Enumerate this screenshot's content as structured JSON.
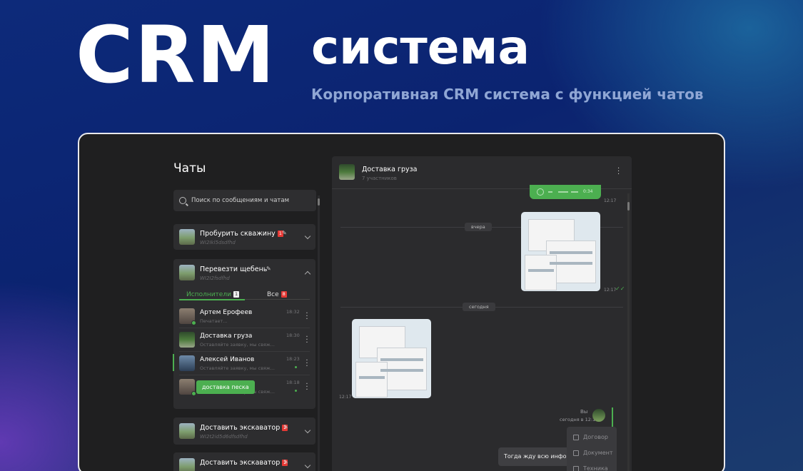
{
  "hero": {
    "title": "CRM",
    "subtitle": "система",
    "tagline": "Корпоративная CRM система с функцией чатов"
  },
  "sidebar": {
    "title": "Чаты",
    "search_placeholder": "Поиск по сообщениям и чатам",
    "cards": [
      {
        "title": "Пробурить скважину",
        "badge": "1",
        "code": "WI2Ikl5dsdfhd"
      },
      {
        "title": "Перевезти щебень",
        "code": "WI2I2fsdfhd"
      },
      {
        "title": "Доставить экскаватор",
        "badge": "2",
        "code": "WI2t2id5d6dfsdfhd"
      },
      {
        "title": "Доставить экскаватор",
        "badge": "2"
      }
    ],
    "tabs": {
      "executors": "Исполнители",
      "executors_count": "1",
      "all": "Все",
      "all_count": "8"
    },
    "people": [
      {
        "name": "Артем Ерофеев",
        "message": "Печатает...",
        "time": "18:32"
      },
      {
        "name": "Доставка груза",
        "message": "Оставляйте заявку, мы свяж...",
        "time": "18:30"
      },
      {
        "name": "Алексей Иванов",
        "message": "Оставляйте заявку, мы свяж...",
        "time": "18:23"
      },
      {
        "name": "",
        "message": "Оставляйте заявку, мы свяж...",
        "time": "18:18"
      }
    ],
    "tooltip": "доставка песка"
  },
  "chat": {
    "title": "Доставка груза",
    "subtitle": "7 участников",
    "voice_time": "0:34",
    "times": [
      "12:17",
      "12:17",
      "12:17"
    ],
    "days": [
      "вчера",
      "сегодня"
    ],
    "you_label": "Вы",
    "you_time": "сегодня в 12:18",
    "bubble_text": "Тогда жду всю информацию",
    "menu": [
      "Договор",
      "Документ",
      "Техника"
    ]
  },
  "colors": {
    "accent": "#4caf50",
    "badge": "#e53935",
    "bg": "#1f1f20"
  }
}
